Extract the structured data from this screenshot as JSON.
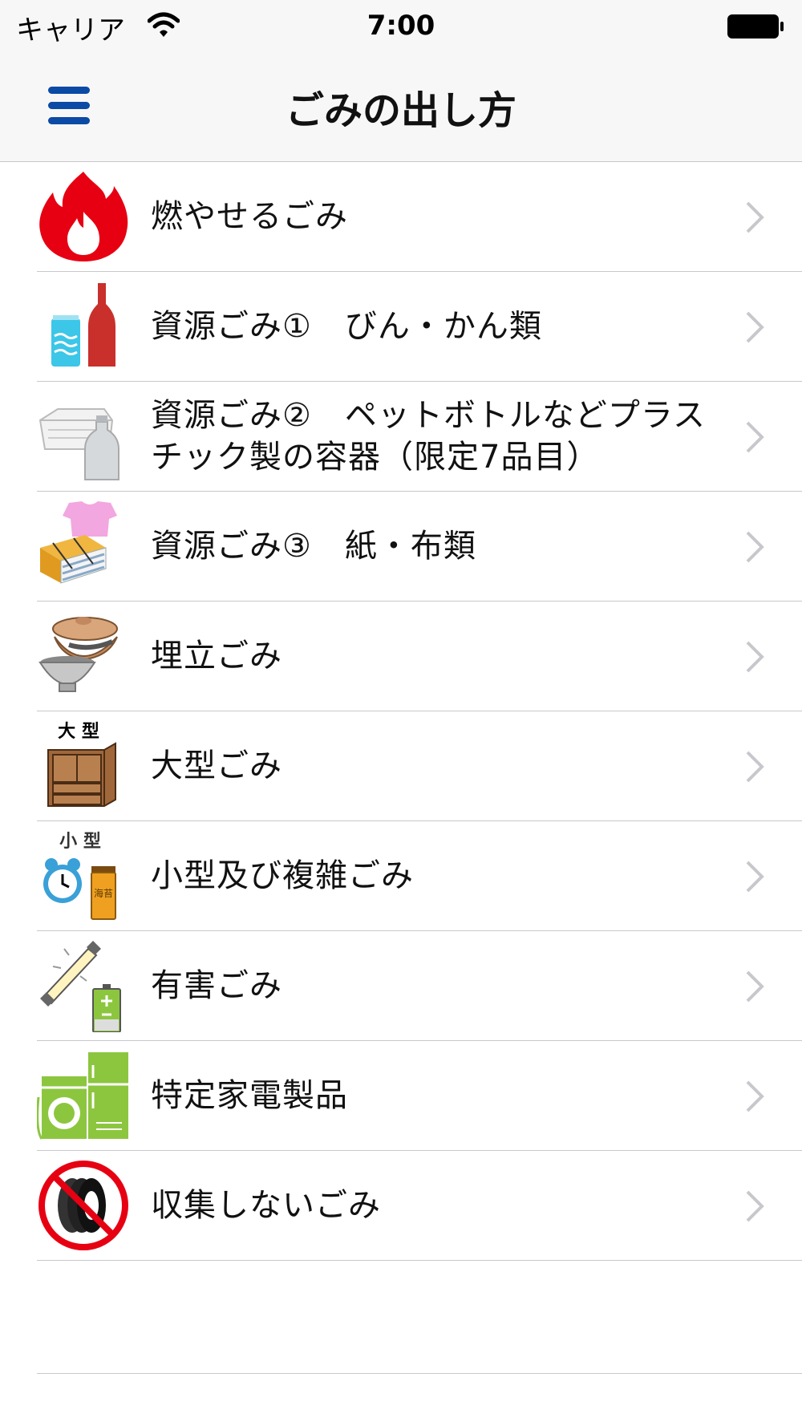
{
  "status_bar": {
    "carrier": "キャリア",
    "time": "7:00"
  },
  "nav": {
    "title": "ごみの出し方"
  },
  "list": {
    "items": [
      {
        "label": "燃やせるごみ",
        "icon": "fire-icon"
      },
      {
        "label": "資源ごみ①　びん・かん類",
        "icon": "can-bottle-icon"
      },
      {
        "label": "資源ごみ②　ペットボトルなどプラスチック製の容器（限定7品目）",
        "icon": "plastic-container-icon"
      },
      {
        "label": "資源ごみ③　紙・布類",
        "icon": "paper-cloth-icon"
      },
      {
        "label": "埋立ごみ",
        "icon": "pottery-icon"
      },
      {
        "label": "大型ごみ",
        "icon": "large-furniture-icon"
      },
      {
        "label": "小型及び複雑ごみ",
        "icon": "small-items-icon"
      },
      {
        "label": "有害ごみ",
        "icon": "hazardous-icon"
      },
      {
        "label": "特定家電製品",
        "icon": "appliance-icon"
      },
      {
        "label": "収集しないごみ",
        "icon": "not-collected-icon"
      }
    ]
  },
  "icon_text": {
    "large": "大 型",
    "small": "小 型",
    "nori": "海苔"
  },
  "colors": {
    "nav_background": "#f7f7f7",
    "menu_icon": "#0b4aa5",
    "separator": "#c8c7cc",
    "chevron": "#c7c7cc",
    "fire": "#e60012",
    "appliance": "#8cc63f"
  }
}
